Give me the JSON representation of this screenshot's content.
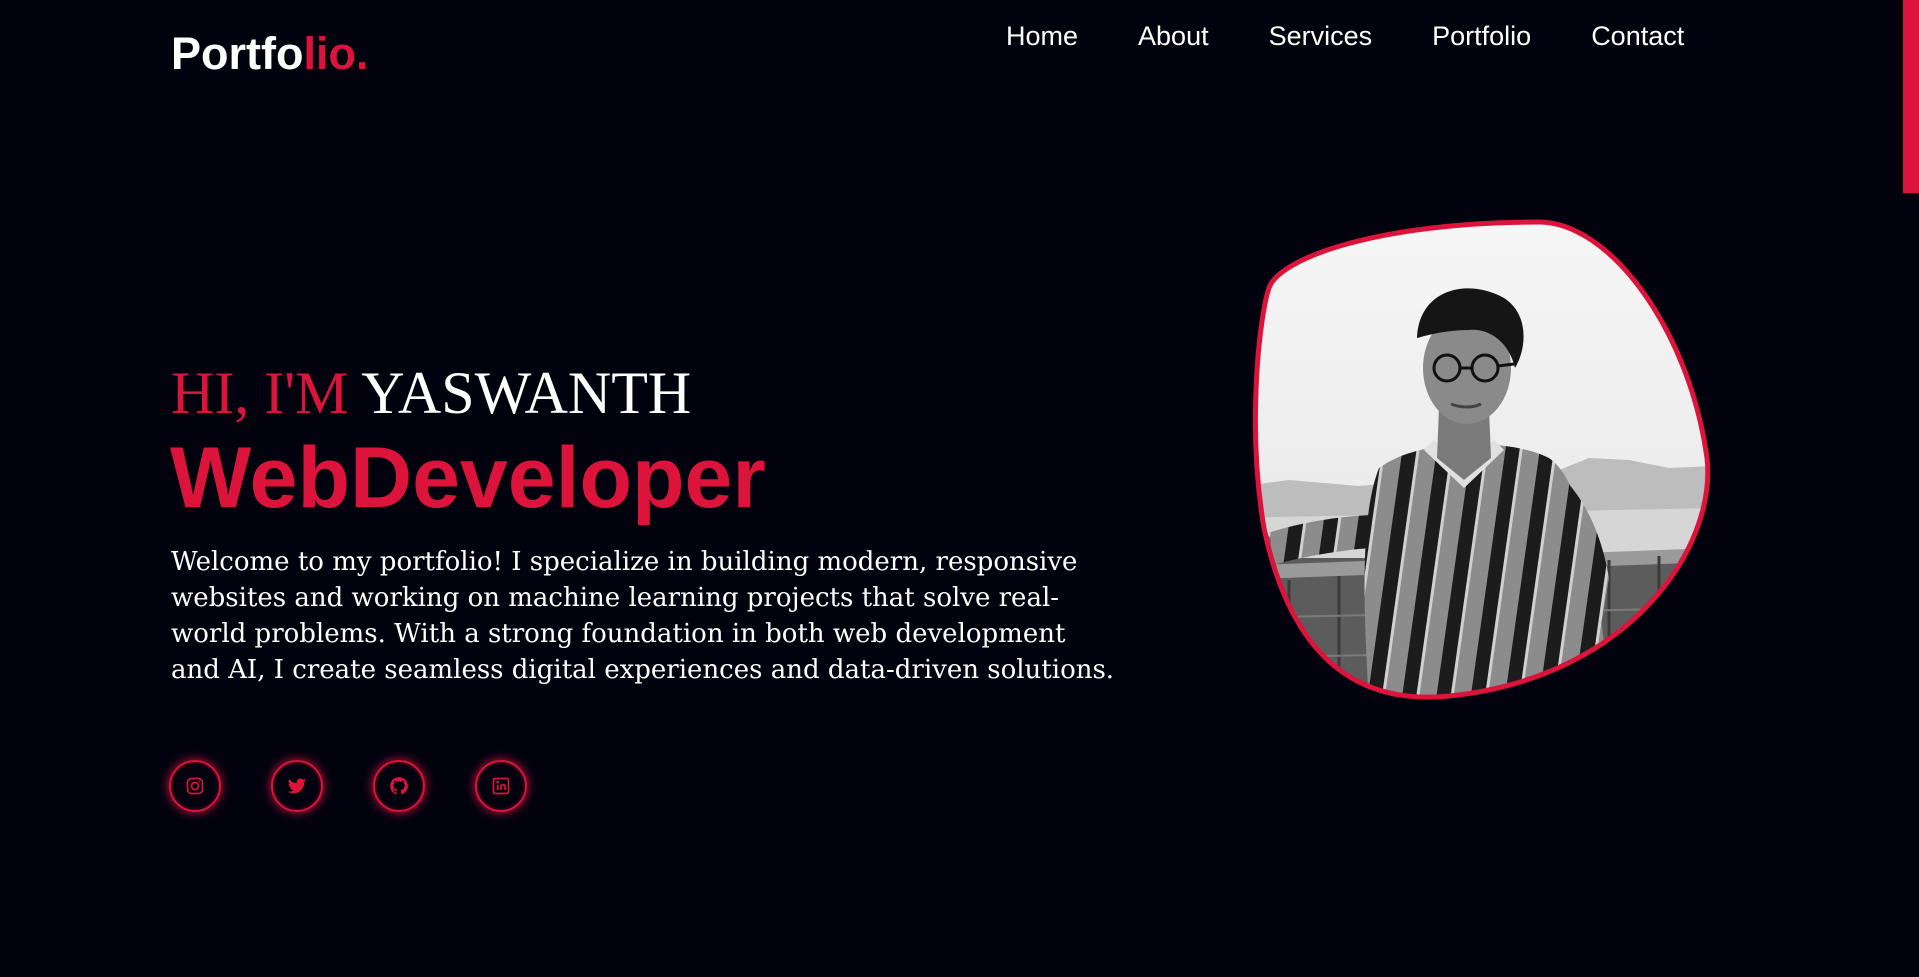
{
  "header": {
    "logo_main": "Portfo",
    "logo_accent": "lio."
  },
  "nav": {
    "items": [
      {
        "label": "Home"
      },
      {
        "label": "About"
      },
      {
        "label": "Services"
      },
      {
        "label": "Portfolio"
      },
      {
        "label": "Contact"
      }
    ]
  },
  "hero": {
    "greeting_prefix": "HI, I'M",
    "name": "YASWANTH",
    "role": "WebDeveloper",
    "intro": "Welcome to my portfolio! I specialize in building modern, responsive websites and working on machine learning projects that solve real-world problems. With a strong foundation in both web development and AI, I create seamless digital experiences and data-driven solutions."
  },
  "socials": [
    {
      "icon": "instagram-icon"
    },
    {
      "icon": "twitter-icon"
    },
    {
      "icon": "github-icon"
    },
    {
      "icon": "linkedin-icon"
    }
  ],
  "colors": {
    "background": "#02020f",
    "accent": "#dc143c",
    "text": "#ffffff"
  }
}
